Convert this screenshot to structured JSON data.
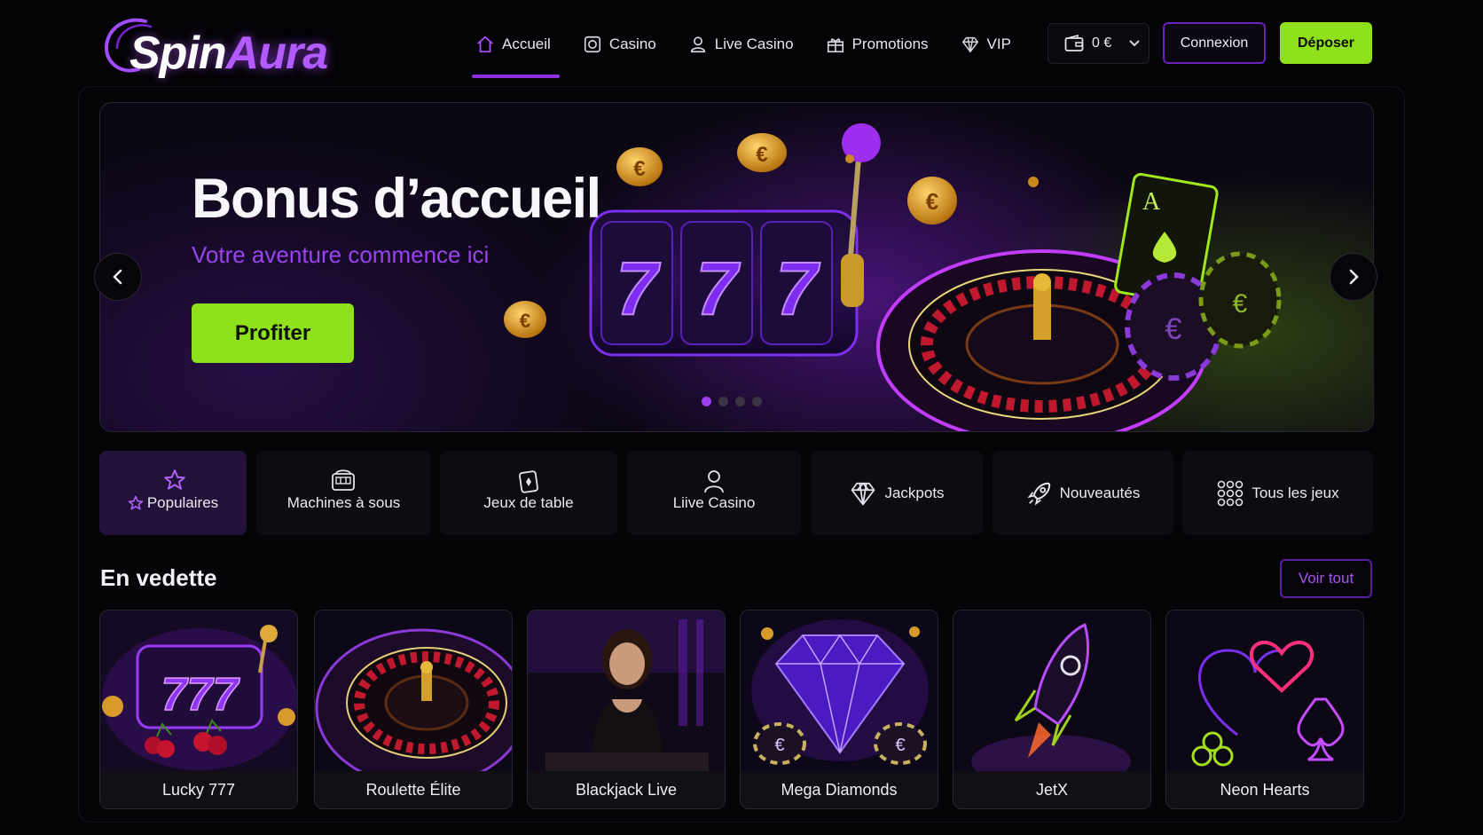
{
  "brand": {
    "part1": "Spin",
    "part2": "Aura"
  },
  "nav": [
    {
      "label": "Accueil",
      "icon": "home-icon",
      "active": true
    },
    {
      "label": "Casino",
      "icon": "casino-chip-icon"
    },
    {
      "label": "Live Casino",
      "icon": "dealer-icon"
    },
    {
      "label": "Promotions",
      "icon": "gift-icon"
    },
    {
      "label": "VIP",
      "icon": "diamond-icon"
    }
  ],
  "wallet": {
    "balance": "0 €",
    "icon": "wallet-icon"
  },
  "header_buttons": {
    "login": "Connexion",
    "deposit": "Déposer"
  },
  "hero": {
    "title": "Bonus d’accueil",
    "subtitle": "Votre aventure commence ici",
    "cta": "Profiter",
    "slides_total": 4,
    "active_slide": 1
  },
  "categories": [
    {
      "label": "Populaires",
      "icon": "star-icon",
      "active": true
    },
    {
      "label": "Machines à sous",
      "icon": "slot-machine-icon"
    },
    {
      "label": "Jeux de table",
      "icon": "cards-icon"
    },
    {
      "label": "Liive Casino",
      "icon": "dealer-icon"
    },
    {
      "label": "Jackpots",
      "icon": "diamond-icon"
    },
    {
      "label": "Nouveautés",
      "icon": "rocket-icon"
    },
    {
      "label": "Tous les jeux",
      "icon": "grid-dots-icon"
    }
  ],
  "featured": {
    "title": "En vedette",
    "see_all": "Voir tout",
    "games": [
      {
        "name": "Lucky 777"
      },
      {
        "name": "Roulette Élite"
      },
      {
        "name": "Blackjack Live"
      },
      {
        "name": "Mega Diamonds"
      },
      {
        "name": "JetX"
      },
      {
        "name": "Neon Hearts"
      }
    ]
  },
  "colors": {
    "accent_purple": "#8e2fe6",
    "accent_green": "#8fe21b",
    "background": "#040306"
  }
}
